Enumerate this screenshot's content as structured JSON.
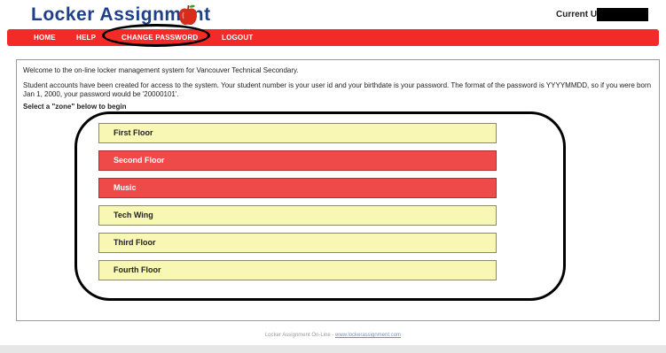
{
  "header": {
    "title": "Locker Assignment",
    "current_user_label": "Current User:"
  },
  "nav": {
    "items": [
      "HOME",
      "HELP",
      "CHANGE PASSWORD",
      "LOGOUT"
    ]
  },
  "main": {
    "welcome": "Welcome to the on-line locker management system for Vancouver Technical Secondary.",
    "accounts_info": "Student accounts have been created for access to the system. Your student number is your user id and your birthdate is your password. The format of the password is YYYYMMDD, so if you were born Jan 1, 2000, your password would be '20000101'.",
    "select_prompt": "Select a \"zone\" below to begin",
    "zones": [
      {
        "label": "First Floor",
        "status": "available"
      },
      {
        "label": "Second Floor",
        "status": "full"
      },
      {
        "label": "Music",
        "status": "full"
      },
      {
        "label": "Tech Wing",
        "status": "available"
      },
      {
        "label": "Third Floor",
        "status": "available"
      },
      {
        "label": "Fourth Floor",
        "status": "available"
      }
    ]
  },
  "footer": {
    "text": "Locker Assignment On-Line - ",
    "link": "www.lockerassignment.com"
  },
  "colors": {
    "brand_blue": "#1f3f8a",
    "nav_red": "#f22a2a",
    "zone_available": "#f8f8b4",
    "zone_full": "#ef4a4a"
  }
}
